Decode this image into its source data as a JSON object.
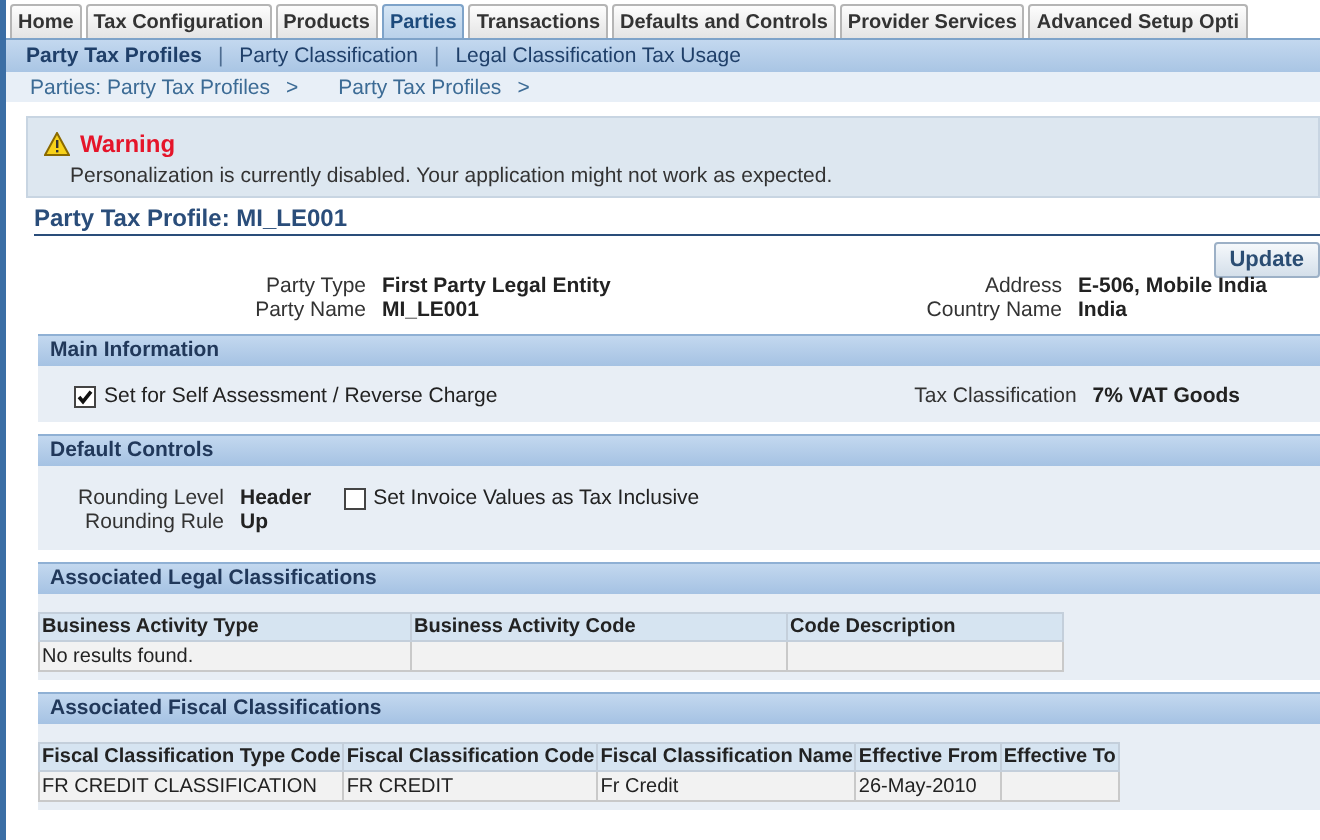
{
  "tabs": [
    {
      "label": "Home",
      "selected": false
    },
    {
      "label": "Tax Configuration",
      "selected": false
    },
    {
      "label": "Products",
      "selected": false
    },
    {
      "label": "Parties",
      "selected": true
    },
    {
      "label": "Transactions",
      "selected": false
    },
    {
      "label": "Defaults and Controls",
      "selected": false
    },
    {
      "label": "Provider Services",
      "selected": false
    },
    {
      "label": "Advanced Setup Opti",
      "selected": false
    }
  ],
  "subtabs": [
    {
      "label": "Party Tax Profiles",
      "selected": true
    },
    {
      "label": "Party Classification",
      "selected": false
    },
    {
      "label": "Legal Classification Tax Usage",
      "selected": false
    }
  ],
  "subtab_separator": "|",
  "breadcrumbs": [
    "Parties: Party Tax Profiles",
    "Party Tax Profiles"
  ],
  "breadcrumb_separator": ">",
  "warning": {
    "title": "Warning",
    "message": "Personalization is currently disabled. Your application might not work as expected."
  },
  "page_title": "Party Tax Profile: MI_LE001",
  "update_button": "Update",
  "header_fields_left": [
    {
      "label": "Party Type",
      "value": "First Party Legal Entity"
    },
    {
      "label": "Party Name",
      "value": "MI_LE001"
    }
  ],
  "header_fields_right": [
    {
      "label": "Address",
      "value": "E-506, Mobile India"
    },
    {
      "label": "Country Name",
      "value": "India"
    }
  ],
  "main_information": {
    "title": "Main Information",
    "checkbox": {
      "label": "Set for Self Assessment / Reverse Charge",
      "checked": true
    },
    "field": {
      "label": "Tax Classification",
      "value": "7% VAT Goods"
    }
  },
  "default_controls": {
    "title": "Default Controls",
    "fields": [
      {
        "label": "Rounding Level",
        "value": "Header"
      },
      {
        "label": "Rounding Rule",
        "value": "Up"
      }
    ],
    "checkbox": {
      "label": "Set Invoice Values as Tax Inclusive",
      "checked": false
    }
  },
  "legal_classifications": {
    "title": "Associated Legal Classifications",
    "columns": [
      "Business Activity Type",
      "Business Activity Code",
      "Code Description"
    ],
    "empty_message": "No results found."
  },
  "fiscal_classifications": {
    "title": "Associated Fiscal Classifications",
    "columns": [
      "Fiscal Classification Type Code",
      "Fiscal Classification Code",
      "Fiscal Classification Name",
      "Effective From",
      "Effective To"
    ],
    "rows": [
      {
        "cells": [
          "FR CREDIT CLASSIFICATION",
          "FR CREDIT",
          "Fr Credit",
          "26-May-2010"
        ]
      }
    ]
  }
}
